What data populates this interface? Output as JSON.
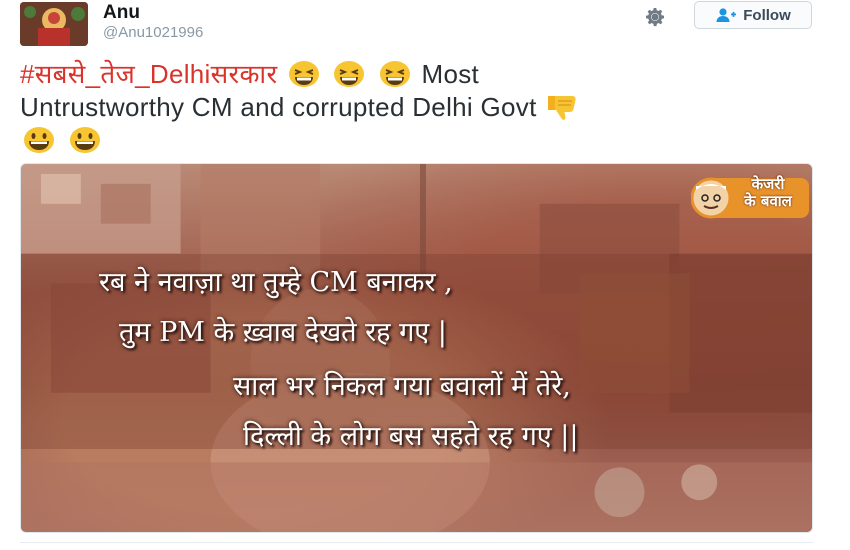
{
  "user": {
    "name": "Anu",
    "handle": "@Anu1021996"
  },
  "actions": {
    "follow_label": "Follow"
  },
  "tweet": {
    "hashtag": "#सबसे_तेज_Delhiसरकार",
    "text_part1": "Most",
    "text_part2": "Untrustworthy CM and corrupted Delhi Govt"
  },
  "media": {
    "lines": [
      "रब ने नवाज़ा था तुम्हे CM बनाकर ,",
      "तुम PM के ख़्वाब देखते रह गए |",
      "साल भर निकल गया बवालों में तेरे,",
      "दिल्ली के लोग बस सहते रह गए ||"
    ],
    "logo_line1": "केजरी",
    "logo_line2": "के बवाल"
  },
  "icons": {
    "gear": "gear-icon",
    "follow": "add-user-icon",
    "laugh": "grinning-squinting-face-icon",
    "smile": "smiling-face-icon",
    "thumbs_down": "thumbs-down-icon"
  },
  "colors": {
    "hashtag": "#d9342b",
    "handle": "#8899a6"
  }
}
